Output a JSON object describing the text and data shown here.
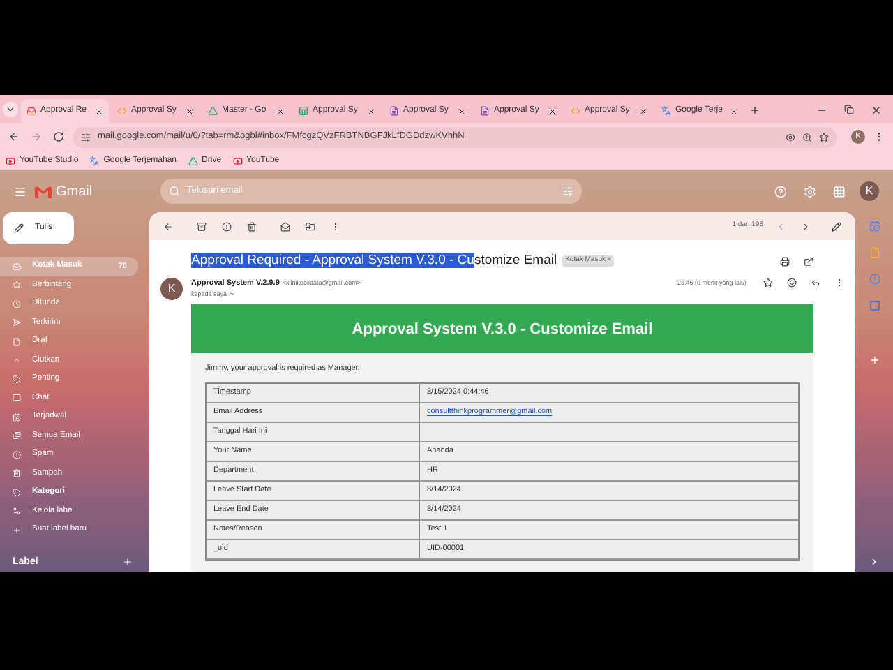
{
  "tabs": [
    {
      "label": "Approval Re",
      "selected": true
    },
    {
      "label": "Approval Sy",
      "selected": false
    },
    {
      "label": "Master - Go",
      "selected": false
    },
    {
      "label": "Approval Sy",
      "selected": false
    },
    {
      "label": "Approval Sy",
      "selected": false
    },
    {
      "label": "Approval Sy",
      "selected": false
    },
    {
      "label": "Approval Sy",
      "selected": false
    },
    {
      "label": "Google Terje",
      "selected": false
    }
  ],
  "address": "mail.google.com/mail/u/0/?tab=rm&ogbl#inbox/FMfcgzQVzFRBTNBGFJkLfDGDdzwKVhhN",
  "profile_initial": "K",
  "bookmarks": [
    {
      "label": "YouTube Studio"
    },
    {
      "label": "Google Terjemahan"
    },
    {
      "label": "Drive"
    },
    {
      "label": "YouTube"
    }
  ],
  "gmail": {
    "logo": "Gmail",
    "search_placeholder": "Telusuri email",
    "compose": "Tulis",
    "account_initial": "K",
    "nav": [
      {
        "label": "Kotak Masuk",
        "count": "70",
        "selected": true
      },
      {
        "label": "Berbintang",
        "selected": false
      },
      {
        "label": "Ditunda",
        "selected": false
      },
      {
        "label": "Terkirim",
        "selected": false
      },
      {
        "label": "Draf",
        "selected": false
      },
      {
        "label": "Ciutkan",
        "selected": false
      },
      {
        "label": "Penting",
        "selected": false
      },
      {
        "label": "Chat",
        "selected": false
      },
      {
        "label": "Terjadwal",
        "selected": false
      },
      {
        "label": "Semua Email",
        "selected": false
      },
      {
        "label": "Spam",
        "selected": false
      },
      {
        "label": "Sampah",
        "selected": false
      },
      {
        "label": "Kategori",
        "selected": false,
        "bold": true
      },
      {
        "label": "Kelola label",
        "selected": false
      },
      {
        "label": "Buat label baru",
        "selected": false
      }
    ],
    "labels_heading": "Label",
    "pager": "1 dari 198",
    "email": {
      "subject_selected": "Approval Required - Approval System V.3.0 - Cu",
      "subject_rest": "stomize Email",
      "label_chip": "Kotak Masuk",
      "chip_close": "×",
      "sender_initial": "K",
      "sender": "Approval System V.2.9.9",
      "sender_email": "<klinikpolidata@gmail.com>",
      "recipient": "kepada saya",
      "time": "23.45 (0 menit yang lalu)",
      "banner": "Approval System V.3.0 - Customize Email",
      "intro": "Jimmy, your approval is required as Manager.",
      "rows": [
        {
          "field": "Timestamp",
          "value": "8/15/2024 0:44:46",
          "kind": "text"
        },
        {
          "field": "Email Address",
          "value": "consultthinkprogrammer@gmail.com",
          "kind": "link"
        },
        {
          "field": "Tanggal Hari Ini",
          "kind": "empty"
        },
        {
          "field": "Your Name",
          "value": "Ananda",
          "kind": "text"
        },
        {
          "field": "Department",
          "value": "HR",
          "kind": "text"
        },
        {
          "field": "Leave Start Date",
          "value": "8/14/2024",
          "kind": "text"
        },
        {
          "field": "Leave End Date",
          "value": "8/14/2024",
          "kind": "text"
        },
        {
          "field": "Notes/Reason",
          "value": "Test 1",
          "kind": "text"
        },
        {
          "field": "_uid",
          "value": "UID-00001",
          "kind": "text"
        }
      ]
    }
  }
}
